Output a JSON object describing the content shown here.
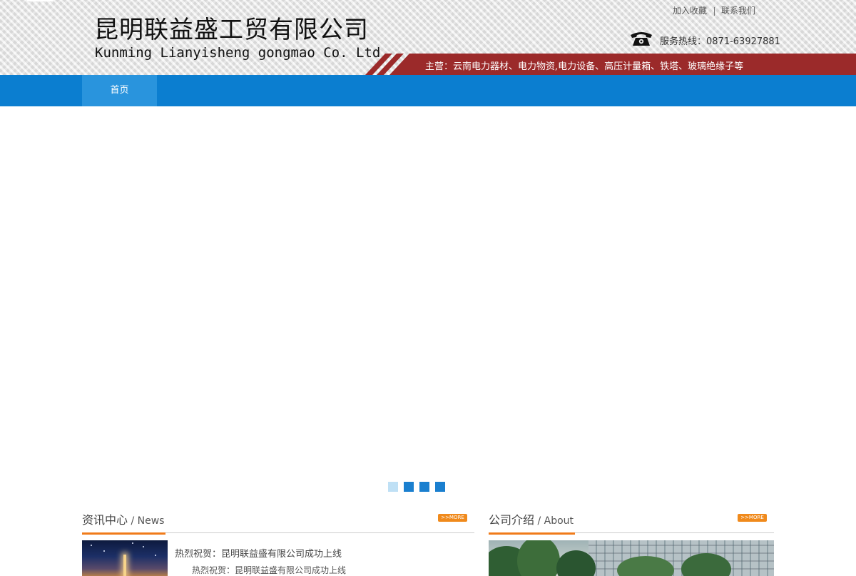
{
  "header": {
    "company_cn": "昆明联益盛工贸有限公司",
    "company_en": "Kunming Lianyisheng gongmao Co. Ltd.",
    "links": {
      "favorite": "加入收藏",
      "contact": "联系我们"
    },
    "hotline": "服务热线：0871-63927881",
    "slogan": "主营：云南电力器材、电力物资,电力设备、高压计量箱、铁塔、玻璃绝缘子等"
  },
  "nav": {
    "items": [
      {
        "label": "首页",
        "active": true
      }
    ]
  },
  "banner": {
    "dots": 4,
    "active_dot": 1
  },
  "news": {
    "title": "资讯中心",
    "sub": " / News",
    "more": ">>MORE",
    "items": [
      {
        "title": "热烈祝贺：昆明联益盛有限公司成功上线",
        "desc": "热烈祝贺：昆明联益盛有限公司成功上线"
      }
    ]
  },
  "about": {
    "title": "公司介绍",
    "sub": " / About",
    "more": ">>MORE"
  },
  "colors": {
    "nav_blue": "#0b7ed0",
    "nav_active": "#2994dd",
    "accent_orange": "#f07b1a",
    "header_red": "#9b2a2a"
  }
}
